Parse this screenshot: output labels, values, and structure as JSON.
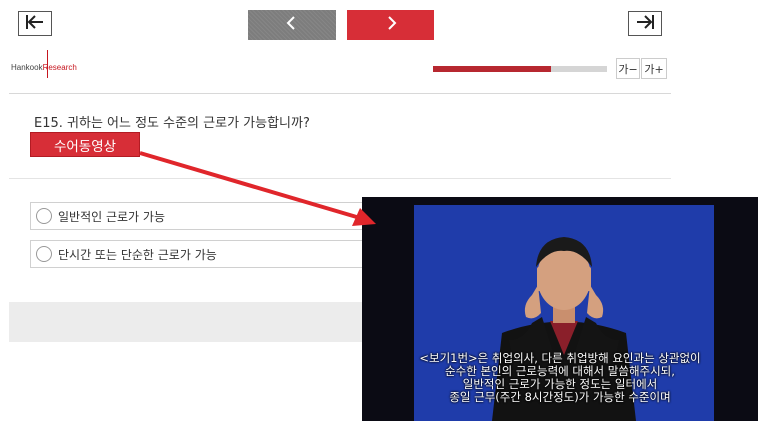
{
  "nav": {
    "first_icon": "first-page-icon",
    "prev_icon": "chevron-left-icon",
    "next_icon": "chevron-right-icon",
    "last_icon": "last-page-icon"
  },
  "brand": {
    "part1": "Hankook",
    "part2": "Research"
  },
  "progress": {
    "fraction": 0.68
  },
  "font_controls": {
    "decrease": "가−",
    "increase": "가+"
  },
  "question": {
    "text": "E15. 귀하는 어느 정도 수준의 근로가 가능합니까?",
    "sign_video_button": "수어동영상"
  },
  "options": [
    {
      "label": "일반적인 근로가 가능"
    },
    {
      "label": "단시간 또는 단순한 근로가 가능"
    }
  ],
  "video": {
    "subtitle_lines": [
      "<보기1번>은 취업의사, 다른 취업방해 요인과는 상관없이",
      "순수한 본인의 근로능력에 대해서 말씀해주시되,",
      "일반적인 근로가 가능한 정도는 일터에서",
      "종일 근무(주간 8시간정도)가 가능한 수준이며"
    ]
  },
  "colors": {
    "accent": "#d72e37",
    "arrow": "#e0262b",
    "video_bg": "#1f3caa"
  }
}
